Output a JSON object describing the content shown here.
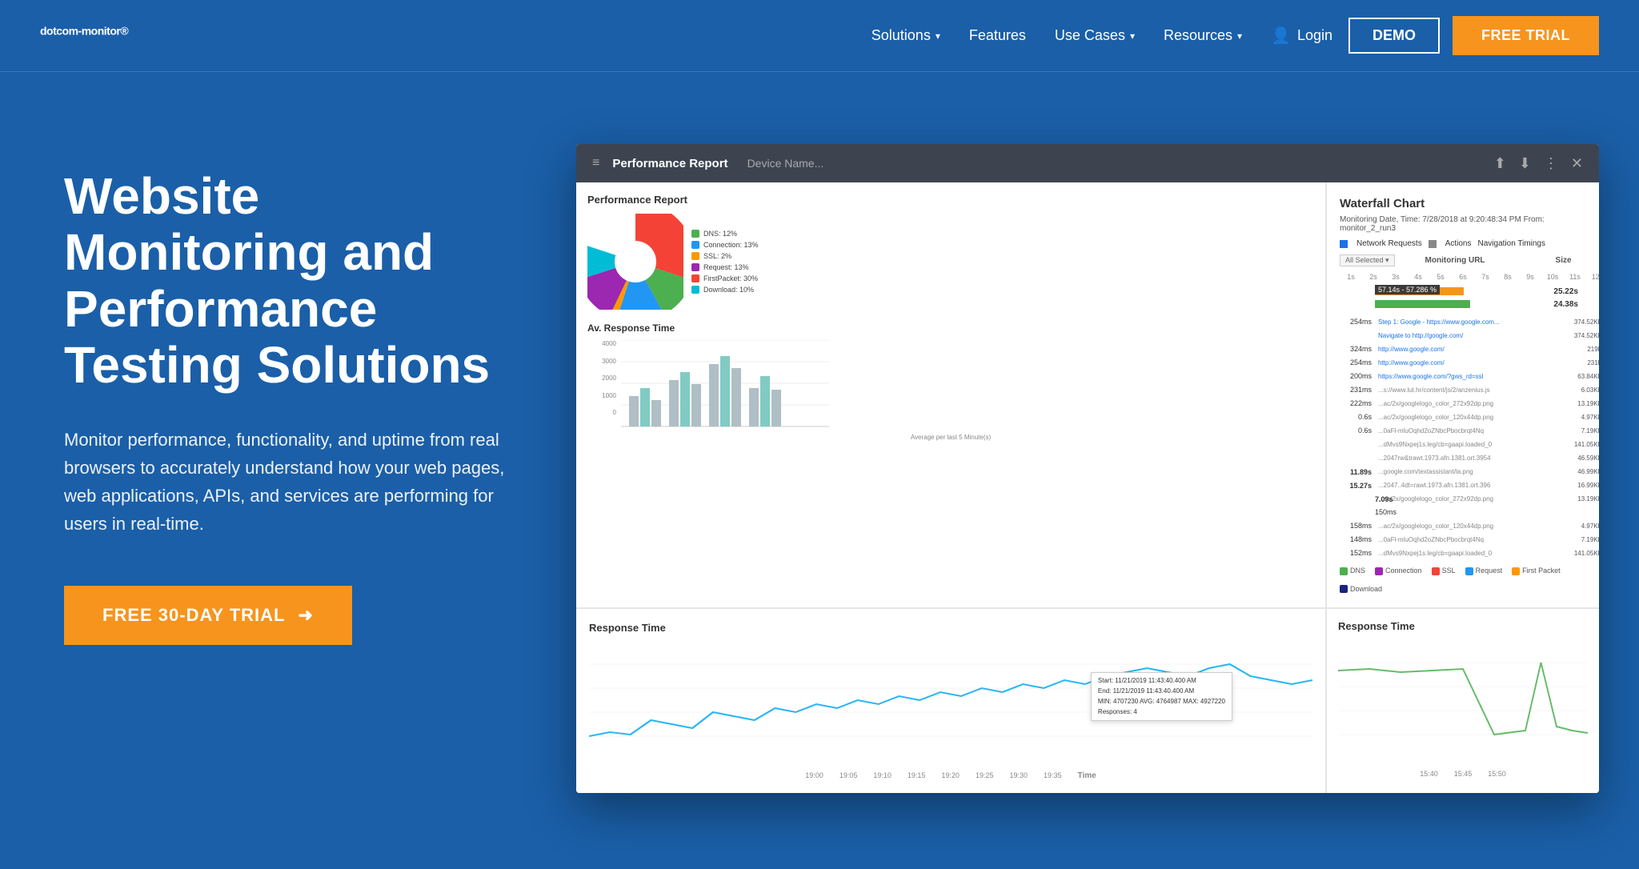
{
  "nav": {
    "logo": "dotcom-monitor",
    "logo_reg": "®",
    "items": [
      {
        "label": "Solutions",
        "has_dropdown": true
      },
      {
        "label": "Features",
        "has_dropdown": false
      },
      {
        "label": "Use Cases",
        "has_dropdown": true
      },
      {
        "label": "Resources",
        "has_dropdown": true
      }
    ],
    "login_label": "Login",
    "demo_label": "DEMO",
    "free_trial_label": "FREE TRIAL"
  },
  "hero": {
    "title": "Website Monitoring and Performance Testing Solutions",
    "description": "Monitor performance, functionality, and uptime from real browsers to accurately understand how your web pages, web applications, APIs, and services are performing for users in real-time.",
    "cta_label": "FREE 30-DAY TRIAL"
  },
  "dashboard": {
    "header_title": "Performance Report",
    "header_device": "Device Name...",
    "waterfall_title": "Waterfall Chart",
    "waterfall_meta": "Monitoring Date, Time: 7/28/2018 at 9:20:48:34 PM  From: monitor_2_run3",
    "performance_report_title": "Performance Report",
    "avg_response_title": "Av. Response Time",
    "avg_response_label": "Average per last 5 Minute(s)",
    "response_time_title": "Response Time",
    "response_time_title2": "Response Time",
    "resp_tooltip": {
      "start": "Start: 11/21/2019 11:43:40.400 AM",
      "end": "End: 11/21/2019 11:43:40.400 AM",
      "min": "MIN: 4707230 AVG: 4764987 MAX: 4927220",
      "responses": "Responses: 4"
    },
    "pie_legend": [
      {
        "label": "DNS: 12%",
        "color": "#4caf50"
      },
      {
        "label": "Connection: 13%",
        "color": "#2196f3"
      },
      {
        "label": "SSL: 2%",
        "color": "#ff9800"
      },
      {
        "label": "Request: 13%",
        "color": "#9c27b0"
      },
      {
        "label": "FirstPacket: 30%",
        "color": "#f44336"
      },
      {
        "label": "Download: 10%",
        "color": "#00bcd4"
      }
    ],
    "wf_legend": [
      {
        "label": "DNS",
        "color": "#4caf50"
      },
      {
        "label": "Connection",
        "color": "#9c27b0"
      },
      {
        "label": "SSL",
        "color": "#f44336"
      },
      {
        "label": "Request",
        "color": "#2196f3"
      },
      {
        "label": "First Packet",
        "color": "#ff9800"
      },
      {
        "label": "Download",
        "color": "#1a237e"
      }
    ]
  },
  "colors": {
    "bg_blue": "#1a5fa8",
    "orange": "#f7941d",
    "nav_bg": "#1a5fa8"
  }
}
